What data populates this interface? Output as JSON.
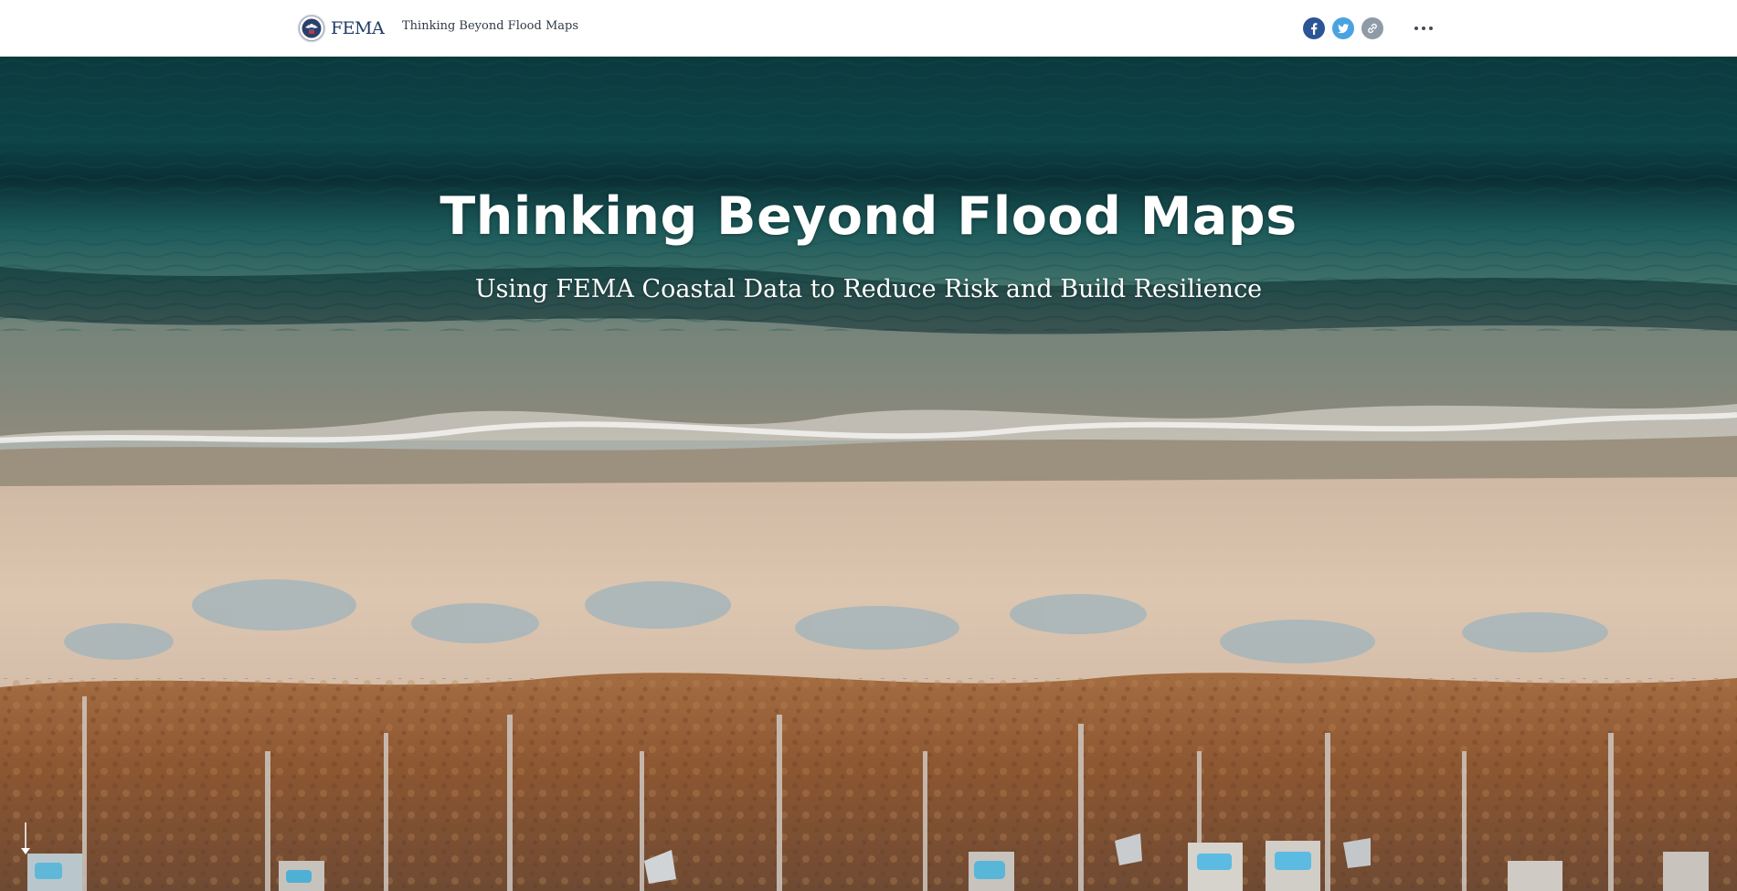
{
  "header": {
    "logo_text": "FEMA",
    "story_title": "Thinking Beyond Flood Maps",
    "share": {
      "facebook_icon": "facebook-icon",
      "twitter_icon": "twitter-icon",
      "link_icon": "link-icon",
      "more_icon": "more-options-icon"
    }
  },
  "hero": {
    "title": "Thinking Beyond Flood Maps",
    "subtitle": "Using FEMA Coastal Data to Reduce Risk and Build Resilience",
    "scroll_icon": "down-arrow-icon"
  },
  "colors": {
    "header_bg": "#ffffff",
    "brand_navy": "#1e3a66",
    "facebook": "#2c5597",
    "twitter": "#4aa3e0",
    "link": "#8e9ba6",
    "ocean_deep": "#0d3a40",
    "sand": "#d9c3ad",
    "vegetation": "#9c6a44"
  }
}
